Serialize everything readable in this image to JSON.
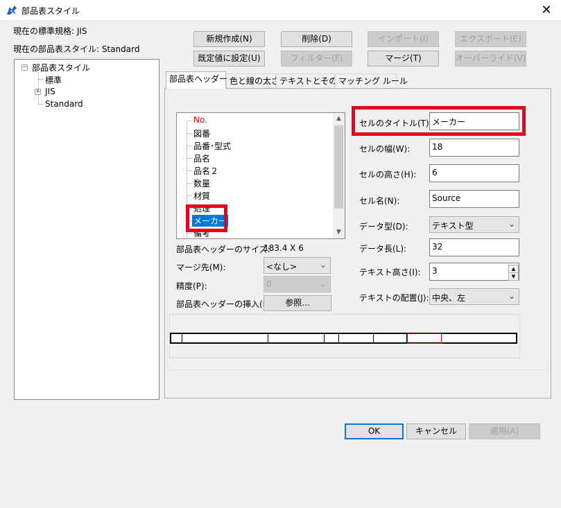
{
  "window": {
    "title": "部品表スタイル",
    "close_glyph": "✕"
  },
  "info": {
    "standard": "現在の標準規格: JIS",
    "bom_style": "現在の部品表スタイル: Standard"
  },
  "toolbar": {
    "new": "新規作成(N)",
    "delete": "削除(D)",
    "import": "インポート(I)",
    "export": "エクスポート(E)",
    "set_default": "既定値に設定(U)",
    "filter": "フィルター(F)",
    "merge": "マージ(T)",
    "override": "オーバーライド(V)"
  },
  "tree": {
    "root": "部品表スタイル",
    "items": [
      "標準",
      "JIS",
      "Standard"
    ]
  },
  "tabs": [
    "部品表ヘッダー",
    "色と線の太さ",
    "テキストとその他",
    "マッチング ルール"
  ],
  "header_list": {
    "items": [
      "No.",
      "図番",
      "品番･型式",
      "品名",
      "品名２",
      "数量",
      "材質",
      "処理",
      "メーカー",
      "備考"
    ],
    "selected": "メーカー",
    "first_color": "#e00000"
  },
  "header_size": {
    "label": "部品表ヘッダーのサイズ:",
    "value": "183.4 X 6"
  },
  "merge_target": {
    "label": "マージ先(M):",
    "value": "<なし>"
  },
  "precision": {
    "label": "精度(P):",
    "value": "0"
  },
  "insert": {
    "label": "部品表ヘッダーの挿入(I):",
    "button": "参照..."
  },
  "fields": {
    "cell_title": {
      "label": "セルのタイトル(T):",
      "value": "メーカー"
    },
    "cell_width": {
      "label": "セルの幅(W):",
      "value": "18"
    },
    "cell_height": {
      "label": "セルの高さ(H):",
      "value": "6"
    },
    "cell_name": {
      "label": "セル名(N):",
      "value": "Source"
    },
    "data_type": {
      "label": "データ型(D):",
      "value": "テキスト型"
    },
    "data_length": {
      "label": "データ長(L):",
      "value": "32"
    },
    "text_height": {
      "label": "テキスト高さ(I):",
      "value": "3"
    },
    "text_align": {
      "label": "テキストの配置(J):",
      "value": "中央、左"
    }
  },
  "footer": {
    "ok": "OK",
    "cancel": "キャンセル",
    "apply": "適用(A)"
  },
  "colors": {
    "highlight": "#e8001c",
    "selection": "#0078d7"
  }
}
